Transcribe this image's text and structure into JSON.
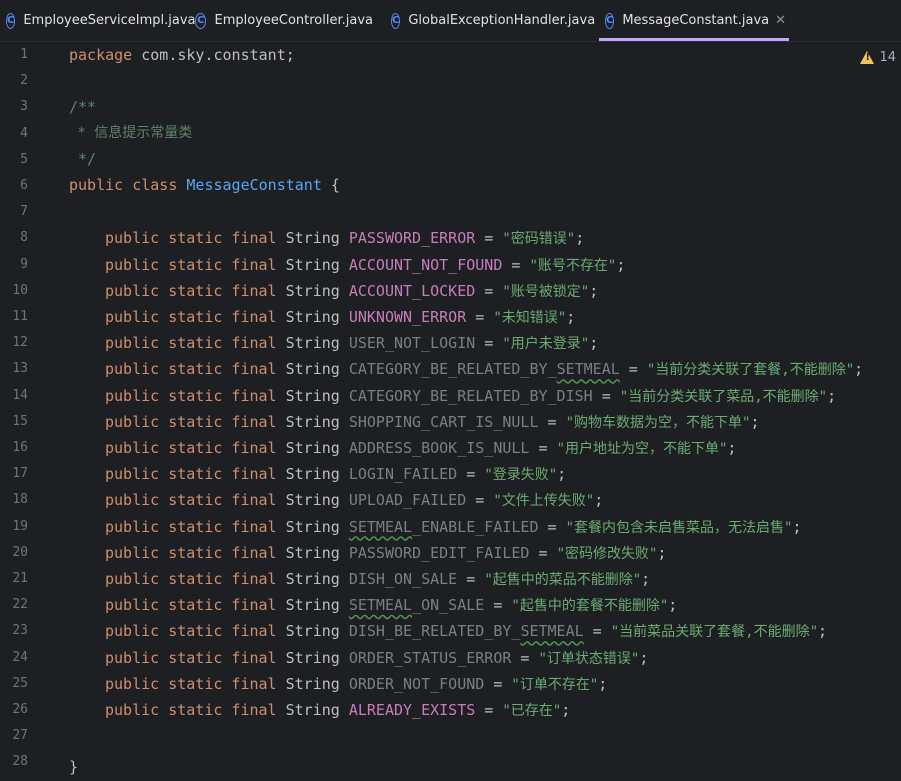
{
  "tabs": [
    {
      "label": "EmployeeServiceImpl.java",
      "icon": "java-class-icon",
      "active": false
    },
    {
      "label": "EmployeeController.java",
      "icon": "java-class-icon",
      "active": false
    },
    {
      "label": "GlobalExceptionHandler.java",
      "icon": "java-class-icon",
      "active": false
    },
    {
      "label": "MessageConstant.java",
      "icon": "java-class-icon",
      "active": true
    }
  ],
  "tab_icon_glyph": "C",
  "close_glyph": "✕",
  "warnings": {
    "count": "14"
  },
  "colors": {
    "background": "#1e1f22",
    "keyword": "#cf8e6d",
    "string": "#6aab73",
    "field": "#c77dbb",
    "class_name": "#56a8f5",
    "comment": "#5f826b",
    "active_tab_underline": "#c4a4ff"
  },
  "line_numbers": [
    "1",
    "2",
    "3",
    "4",
    "5",
    "6",
    "7",
    "8",
    "9",
    "10",
    "11",
    "12",
    "13",
    "14",
    "15",
    "16",
    "17",
    "18",
    "19",
    "20",
    "21",
    "22",
    "23",
    "24",
    "25",
    "26",
    "27",
    "28"
  ],
  "code": {
    "line1": {
      "kw": "package",
      "text": " com.sky.constant;"
    },
    "line3": "/**",
    "line4": " * 信息提示常量类",
    "line5": " */",
    "line6": {
      "kw1": "public",
      "kw2": "class",
      "name": "MessageConstant",
      "brace": " {"
    },
    "modifiers": "public static final",
    "type": "String",
    "constants": [
      {
        "name": "PASSWORD_ERROR",
        "value": "\"密码错误\"",
        "used": true,
        "squiggle": ""
      },
      {
        "name": "ACCOUNT_NOT_FOUND",
        "value": "\"账号不存在\"",
        "used": true,
        "squiggle": ""
      },
      {
        "name": "ACCOUNT_LOCKED",
        "value": "\"账号被锁定\"",
        "used": true,
        "squiggle": ""
      },
      {
        "name": "UNKNOWN_ERROR",
        "value": "\"未知错误\"",
        "used": true,
        "squiggle": ""
      },
      {
        "name": "USER_NOT_LOGIN",
        "value": "\"用户未登录\"",
        "used": false,
        "squiggle": ""
      },
      {
        "name": "CATEGORY_BE_RELATED_BY_SETMEAL",
        "value": "\"当前分类关联了套餐,不能删除\"",
        "used": false,
        "squiggle": "SETMEAL"
      },
      {
        "name": "CATEGORY_BE_RELATED_BY_DISH",
        "value": "\"当前分类关联了菜品,不能删除\"",
        "used": false,
        "squiggle": ""
      },
      {
        "name": "SHOPPING_CART_IS_NULL",
        "value": "\"购物车数据为空，不能下单\"",
        "used": false,
        "squiggle": ""
      },
      {
        "name": "ADDRESS_BOOK_IS_NULL",
        "value": "\"用户地址为空，不能下单\"",
        "used": false,
        "squiggle": ""
      },
      {
        "name": "LOGIN_FAILED",
        "value": "\"登录失败\"",
        "used": false,
        "squiggle": ""
      },
      {
        "name": "UPLOAD_FAILED",
        "value": "\"文件上传失败\"",
        "used": false,
        "squiggle": ""
      },
      {
        "name": "SETMEAL_ENABLE_FAILED",
        "value": "\"套餐内包含未启售菜品，无法启售\"",
        "used": false,
        "squiggle": "SETMEAL"
      },
      {
        "name": "PASSWORD_EDIT_FAILED",
        "value": "\"密码修改失败\"",
        "used": false,
        "squiggle": ""
      },
      {
        "name": "DISH_ON_SALE",
        "value": "\"起售中的菜品不能删除\"",
        "used": false,
        "squiggle": ""
      },
      {
        "name": "SETMEAL_ON_SALE",
        "value": "\"起售中的套餐不能删除\"",
        "used": false,
        "squiggle": "SETMEAL"
      },
      {
        "name": "DISH_BE_RELATED_BY_SETMEAL",
        "value": "\"当前菜品关联了套餐,不能删除\"",
        "used": false,
        "squiggle": "SETMEAL"
      },
      {
        "name": "ORDER_STATUS_ERROR",
        "value": "\"订单状态错误\"",
        "used": false,
        "squiggle": ""
      },
      {
        "name": "ORDER_NOT_FOUND",
        "value": "\"订单不存在\"",
        "used": false,
        "squiggle": ""
      },
      {
        "name": "ALREADY_EXISTS",
        "value": "\"已存在\"",
        "used": true,
        "squiggle": ""
      }
    ],
    "closing_brace": "}"
  }
}
